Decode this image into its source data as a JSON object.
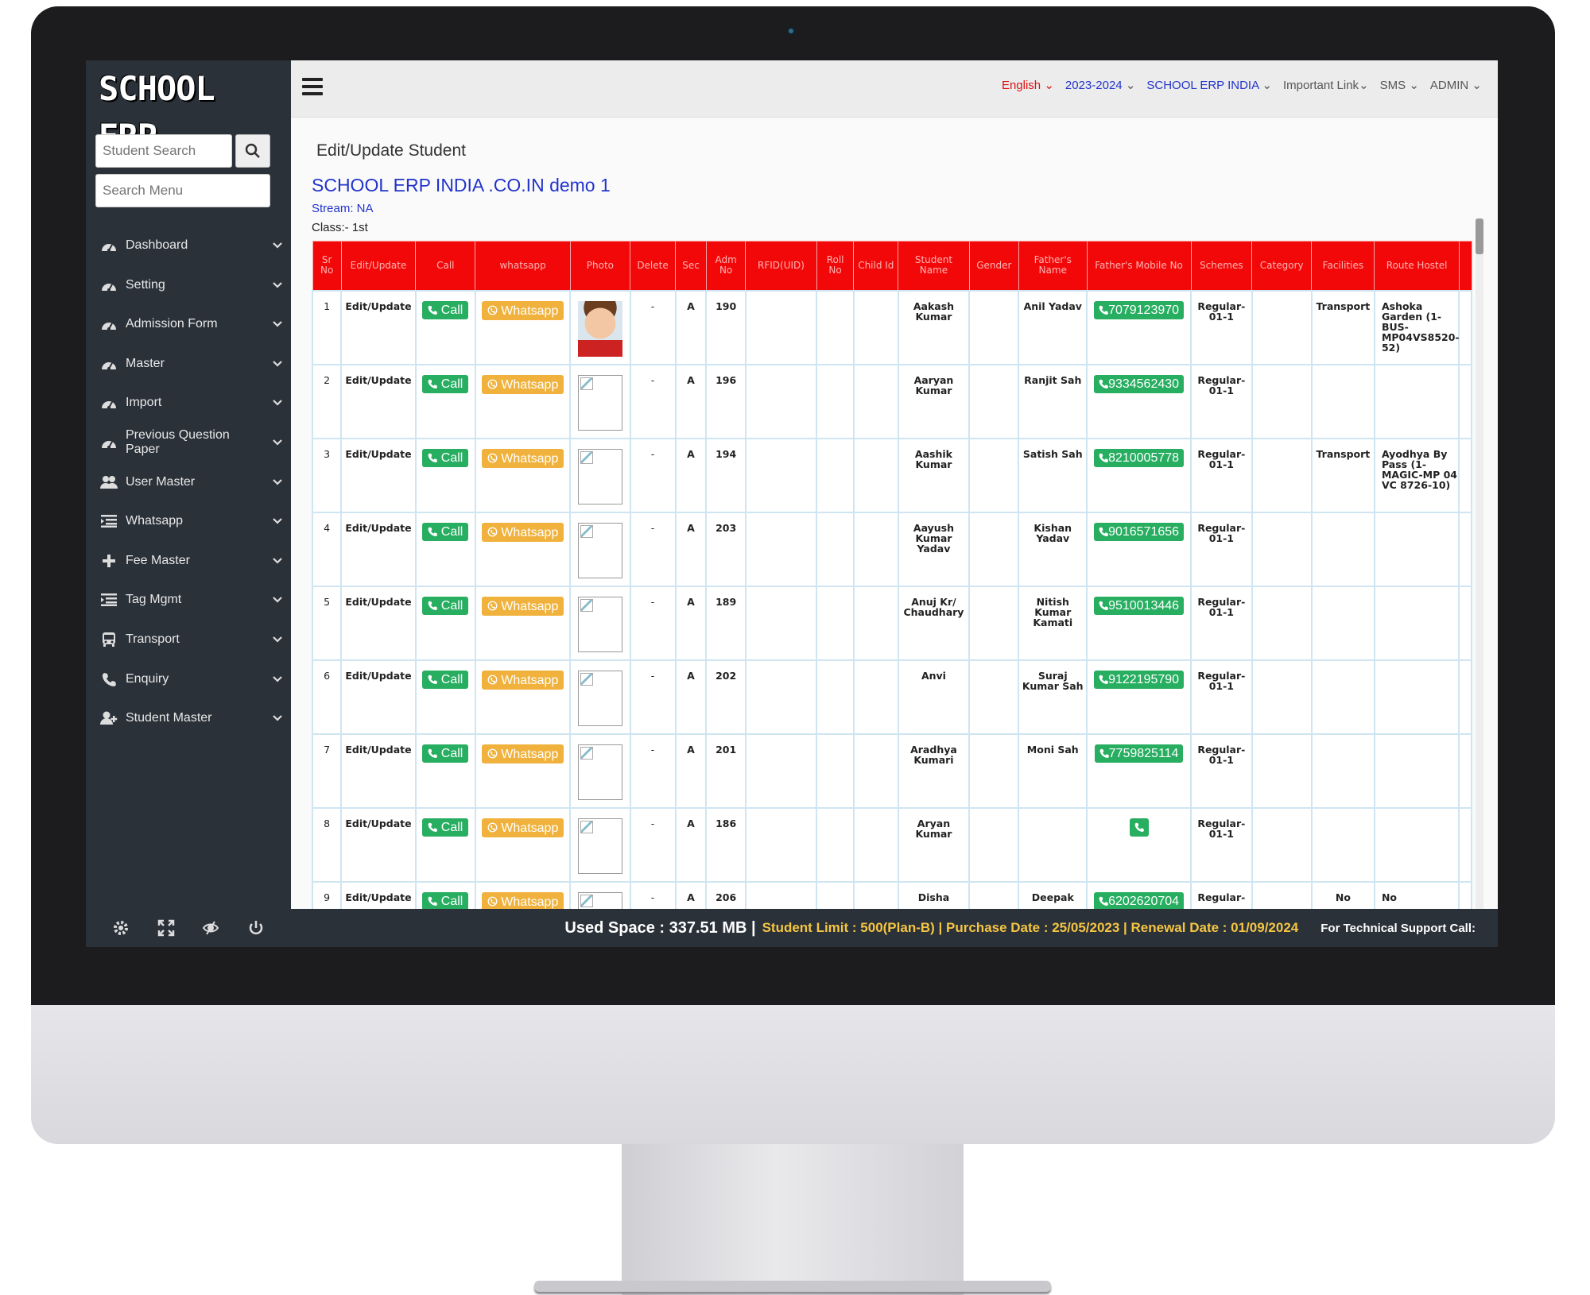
{
  "sidebar": {
    "logo": "SCHOOL ERP",
    "student_search_placeholder": "Student Search",
    "menu_search_placeholder": "Search Menu",
    "items": [
      {
        "label": "Dashboard",
        "icon": "dashboard-icon"
      },
      {
        "label": "Setting",
        "icon": "dashboard-icon"
      },
      {
        "label": "Admission Form",
        "icon": "dashboard-icon"
      },
      {
        "label": "Master",
        "icon": "dashboard-icon"
      },
      {
        "label": "Import",
        "icon": "dashboard-icon"
      },
      {
        "label": "Previous Question Paper",
        "icon": "dashboard-icon"
      },
      {
        "label": "User Master",
        "icon": "users-icon"
      },
      {
        "label": "Whatsapp",
        "icon": "list-icon"
      },
      {
        "label": "Fee Master",
        "icon": "plus-icon"
      },
      {
        "label": "Tag Mgmt",
        "icon": "list-icon"
      },
      {
        "label": "Transport",
        "icon": "bus-icon"
      },
      {
        "label": "Enquiry",
        "icon": "phone-icon"
      },
      {
        "label": "Student Master",
        "icon": "user-plus-icon"
      }
    ]
  },
  "topbar": {
    "language": "English",
    "session": "2023-2024",
    "school": "SCHOOL ERP INDIA",
    "important_link": "Important Link",
    "sms": "SMS",
    "admin": "ADMIN",
    "chevron": "⌄"
  },
  "main": {
    "title": "Edit/Update Student",
    "school_name": "SCHOOL ERP INDIA .CO.IN demo 1",
    "stream": "Stream: NA",
    "class": "Class:- 1st",
    "columns": [
      "Sr No",
      "Edit/Update",
      "Call",
      "whatsapp",
      "Photo",
      "Delete",
      "Sec",
      "Adm No",
      "RFID(UID)",
      "Roll No",
      "Child Id",
      "Student Name",
      "Gender",
      "Father's Name",
      "Father's Mobile No",
      "Schemes",
      "Category",
      "Facilities",
      "Route Hostel"
    ],
    "edit_label": "Edit/Update",
    "call_label": "Call",
    "whatsapp_label": "Whatsapp",
    "rows": [
      {
        "sr": "1",
        "delete": "-",
        "sec": "A",
        "adm": "190",
        "student": "Aakash Kumar",
        "father": "Anil Yadav",
        "mobile": "7079123970",
        "scheme": "Regular-01-1",
        "facilities": "Transport",
        "route": "Ashoka Garden (1-BUS-MP04VS8520-52)",
        "photo": "student-photo"
      },
      {
        "sr": "2",
        "delete": "-",
        "sec": "A",
        "adm": "196",
        "student": "Aaryan Kumar",
        "father": "Ranjit Sah",
        "mobile": "9334562430",
        "scheme": "Regular-01-1",
        "facilities": "",
        "route": "",
        "photo": "broken-image"
      },
      {
        "sr": "3",
        "delete": "-",
        "sec": "A",
        "adm": "194",
        "student": "Aashik Kumar",
        "father": "Satish Sah",
        "mobile": "8210005778",
        "scheme": "Regular-01-1",
        "facilities": "Transport",
        "route": "Ayodhya By Pass (1-MAGIC-MP 04 VC 8726-10)",
        "photo": "broken-image"
      },
      {
        "sr": "4",
        "delete": "-",
        "sec": "A",
        "adm": "203",
        "student": "Aayush Kumar Yadav",
        "father": "Kishan Yadav",
        "mobile": "9016571656",
        "scheme": "Regular-01-1",
        "facilities": "",
        "route": "",
        "photo": "broken-image"
      },
      {
        "sr": "5",
        "delete": "-",
        "sec": "A",
        "adm": "189",
        "student": "Anuj Kr/ Chaudhary",
        "father": "Nitish Kumar Kamati",
        "mobile": "9510013446",
        "scheme": "Regular-01-1",
        "facilities": "",
        "route": "",
        "photo": "broken-image"
      },
      {
        "sr": "6",
        "delete": "-",
        "sec": "A",
        "adm": "202",
        "student": "Anvi",
        "father": "Suraj Kumar Sah",
        "mobile": "9122195790",
        "scheme": "Regular-01-1",
        "facilities": "",
        "route": "",
        "photo": "broken-image"
      },
      {
        "sr": "7",
        "delete": "-",
        "sec": "A",
        "adm": "201",
        "student": "Aradhya Kumari",
        "father": "Moni Sah",
        "mobile": "7759825114",
        "scheme": "Regular-01-1",
        "facilities": "",
        "route": "",
        "photo": "broken-image"
      },
      {
        "sr": "8",
        "delete": "-",
        "sec": "A",
        "adm": "186",
        "student": "Aryan Kumar",
        "father": "",
        "mobile": "",
        "scheme": "Regular-01-1",
        "facilities": "",
        "route": "",
        "photo": "broken-image"
      },
      {
        "sr": "9",
        "delete": "-",
        "sec": "A",
        "adm": "206",
        "student": "Disha",
        "father": "Deepak",
        "mobile": "6202620704",
        "scheme": "Regular-",
        "facilities": "No",
        "route": "No",
        "photo": "broken-image"
      }
    ]
  },
  "footer": {
    "used_space": "Used Space : 337.51 MB |",
    "limit_info": "Student Limit : 500(Plan-B) | Purchase Date : 25/05/2023 | Renewal Date : 01/09/2024",
    "support": "For Technical Support Call:"
  },
  "colors": {
    "sidebar_bg": "#2a3139",
    "table_header": "#f20808",
    "call_green": "#27ae60",
    "whatsapp_orange": "#f0b23c",
    "link_blue": "#2233cc",
    "language_red": "#dd1111",
    "limit_yellow": "#f5c542"
  }
}
